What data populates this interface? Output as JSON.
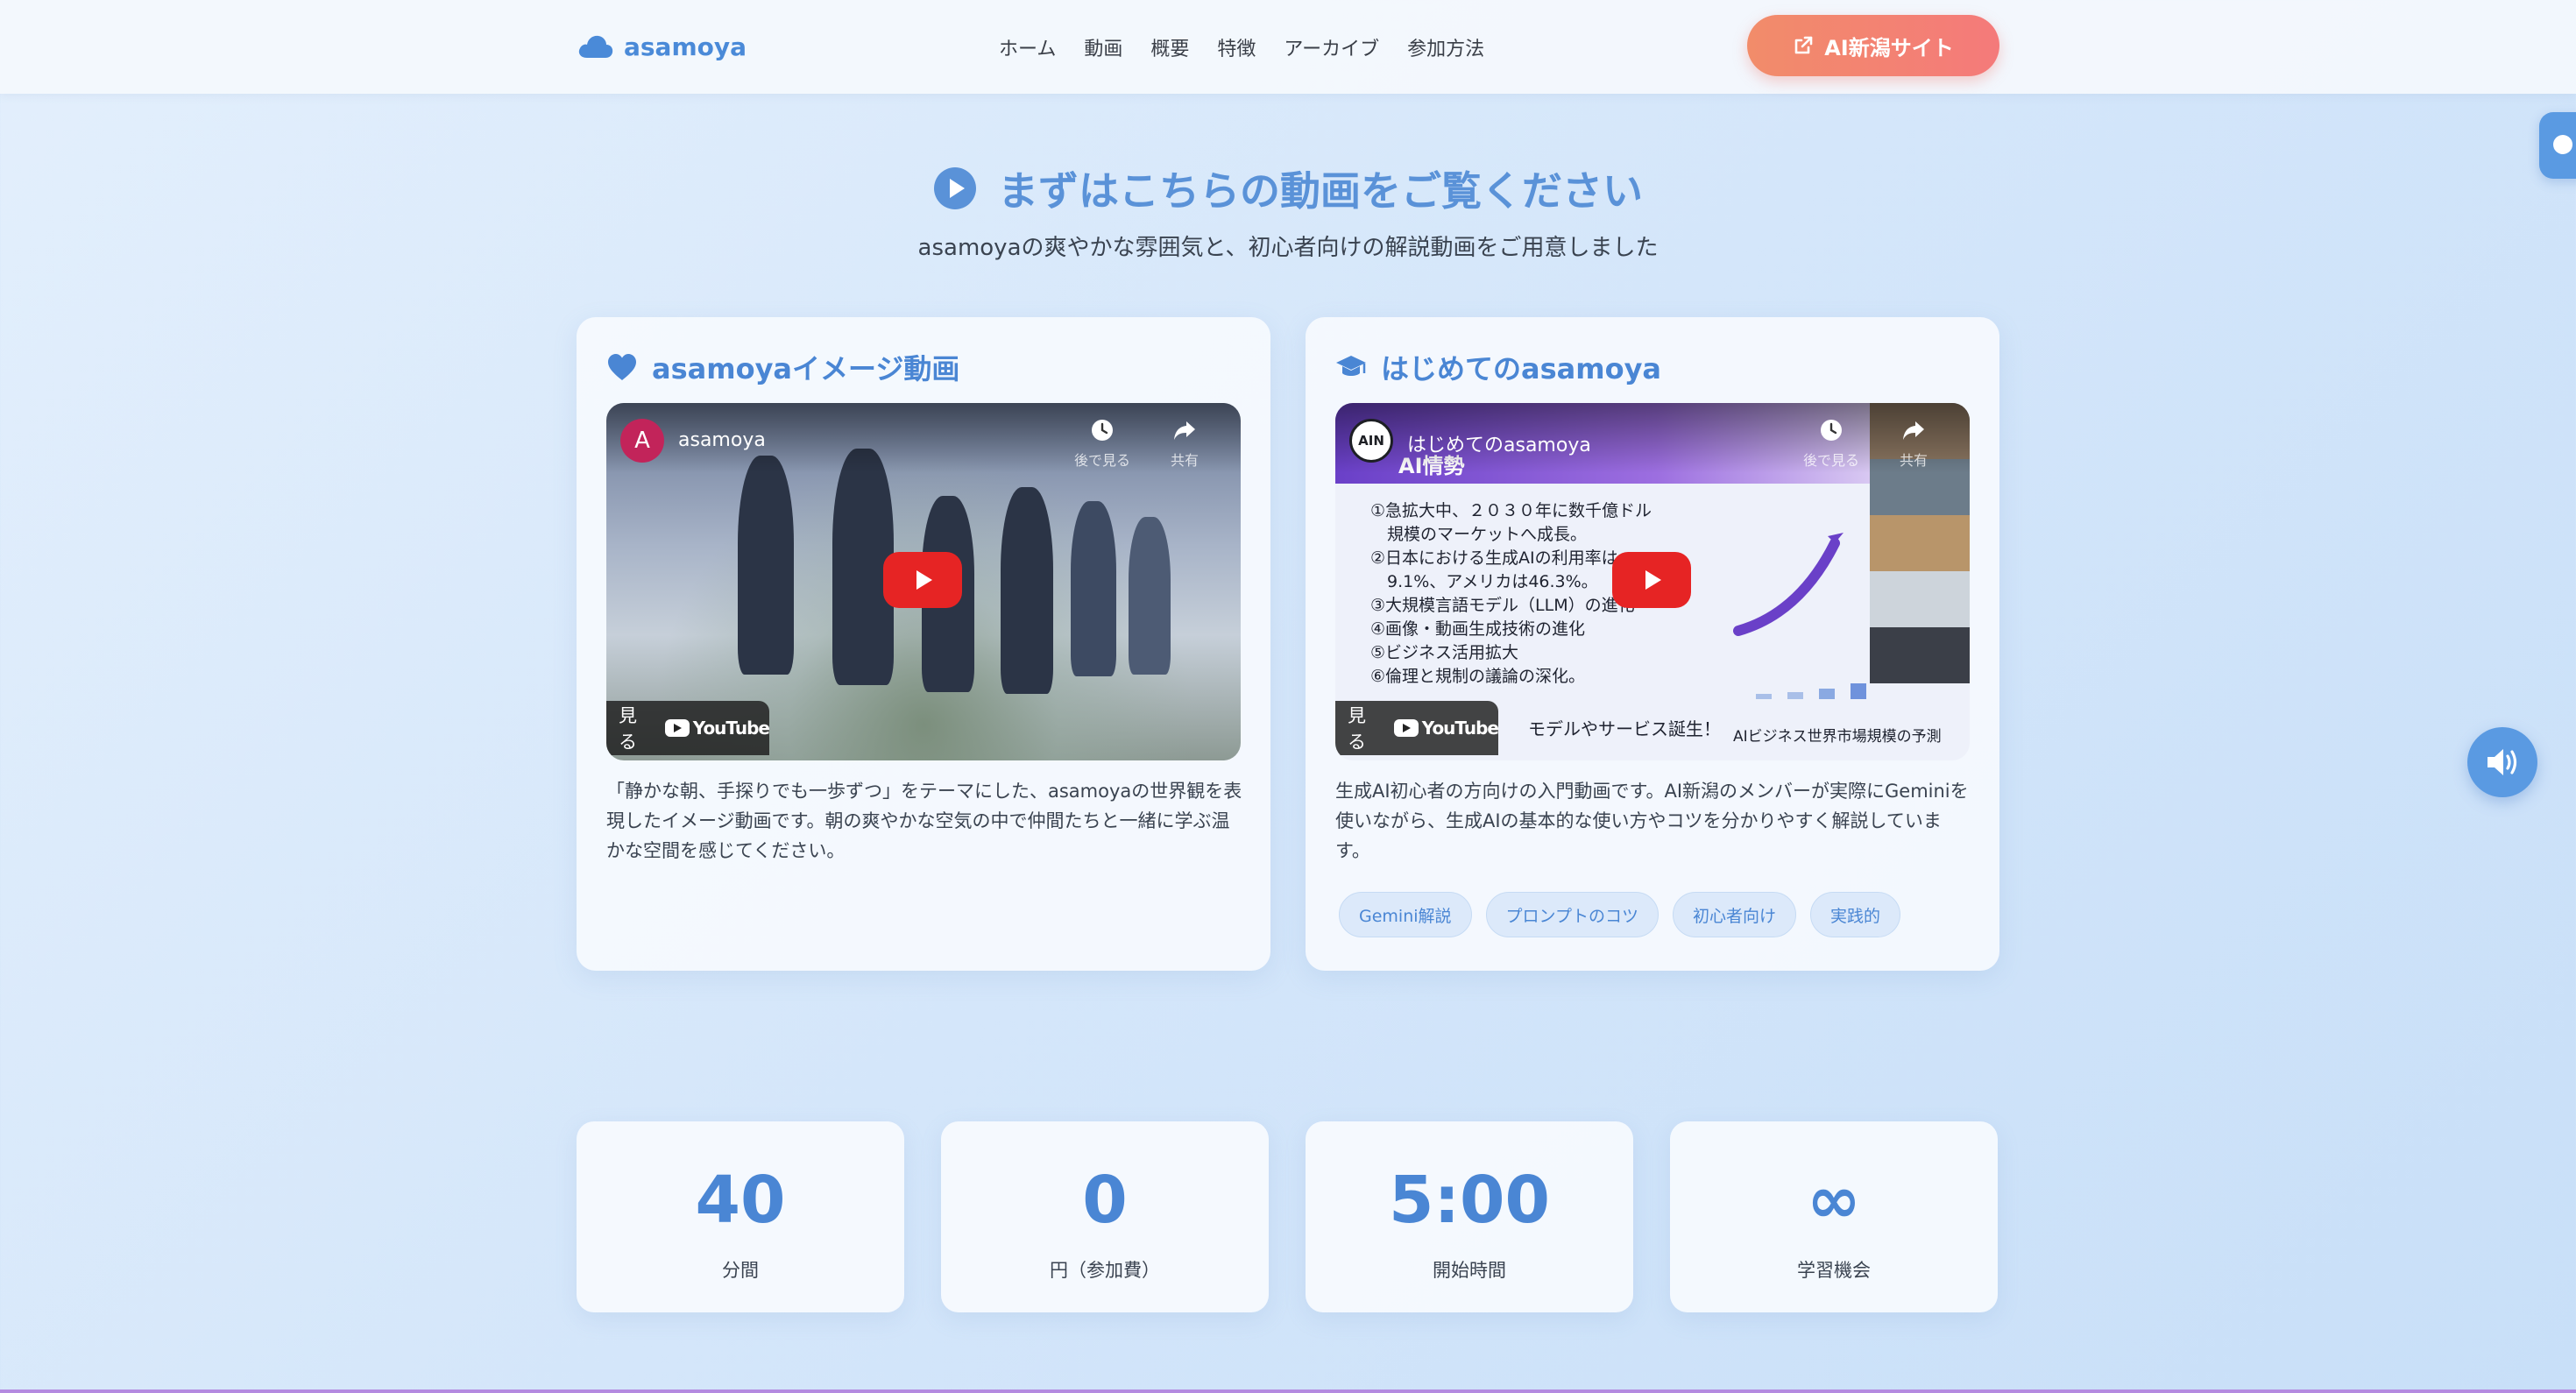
{
  "header": {
    "logo_text": "asamoya",
    "nav": [
      "ホーム",
      "動画",
      "概要",
      "特徴",
      "アーカイブ",
      "参加方法"
    ],
    "cta_label": "AI新潟サイト"
  },
  "section": {
    "title": "まずはこちらの動画をご覧ください",
    "subtitle": "asamoyaの爽やかな雰囲気と、初心者向けの解説動画をご用意しました"
  },
  "cards": [
    {
      "title": "asamoyaイメージ動画",
      "icon": "heart-icon",
      "video": {
        "channel_initial": "A",
        "channel_name": "asamoya",
        "watch_later": "後で見る",
        "share": "共有",
        "watch_on": "見る",
        "youtube": "YouTube"
      },
      "description": "「静かな朝、手探りでも一歩ずつ」をテーマにした、asamoyaの世界観を表現したイメージ動画です。朝の爽やかな空気の中で仲間たちと一緒に学ぶ温かな空間を感じてください。"
    },
    {
      "title": "はじめてのasamoya",
      "icon": "graduation-cap-icon",
      "video": {
        "channel_initial": "AIN",
        "channel_name": "はじめてのasamoya",
        "watch_later": "後で見る",
        "share": "共有",
        "watch_on": "見る",
        "youtube": "YouTube",
        "slide_heading": "AI情勢",
        "slide_items": [
          "①急拡大中、２０３０年に数千億ドル",
          "　規模のマーケットへ成長。",
          "②日本における生成AIの利用率は",
          "　9.1%、アメリカは46.3%。",
          "③大規模言語モデル（LLM）の進化",
          "④画像・動画生成技術の進化",
          "⑤ビジネス活用拡大",
          "⑥倫理と規制の議論の深化。"
        ],
        "slide_footer": "モデルやサービス誕生！",
        "slide_caption": "AIビジネス世界市場規模の予測"
      },
      "description": "生成AI初心者の方向けの入門動画です。AI新潟のメンバーが実際にGeminiを使いながら、生成AIの基本的な使い方やコツを分かりやすく解説しています。",
      "tags": [
        "Gemini解説",
        "プロンプトのコツ",
        "初心者向け",
        "実践的"
      ]
    }
  ],
  "stats": [
    {
      "value": "40",
      "label": "分間"
    },
    {
      "value": "0",
      "label": "円（参加費）"
    },
    {
      "value": "5:00",
      "label": "開始時間"
    },
    {
      "value": "∞",
      "label": "学習機会"
    }
  ],
  "colors": {
    "accent": "#4a86d4",
    "cta_start": "#f28c6a",
    "cta_end": "#f47a7a",
    "play": "#e62424"
  }
}
